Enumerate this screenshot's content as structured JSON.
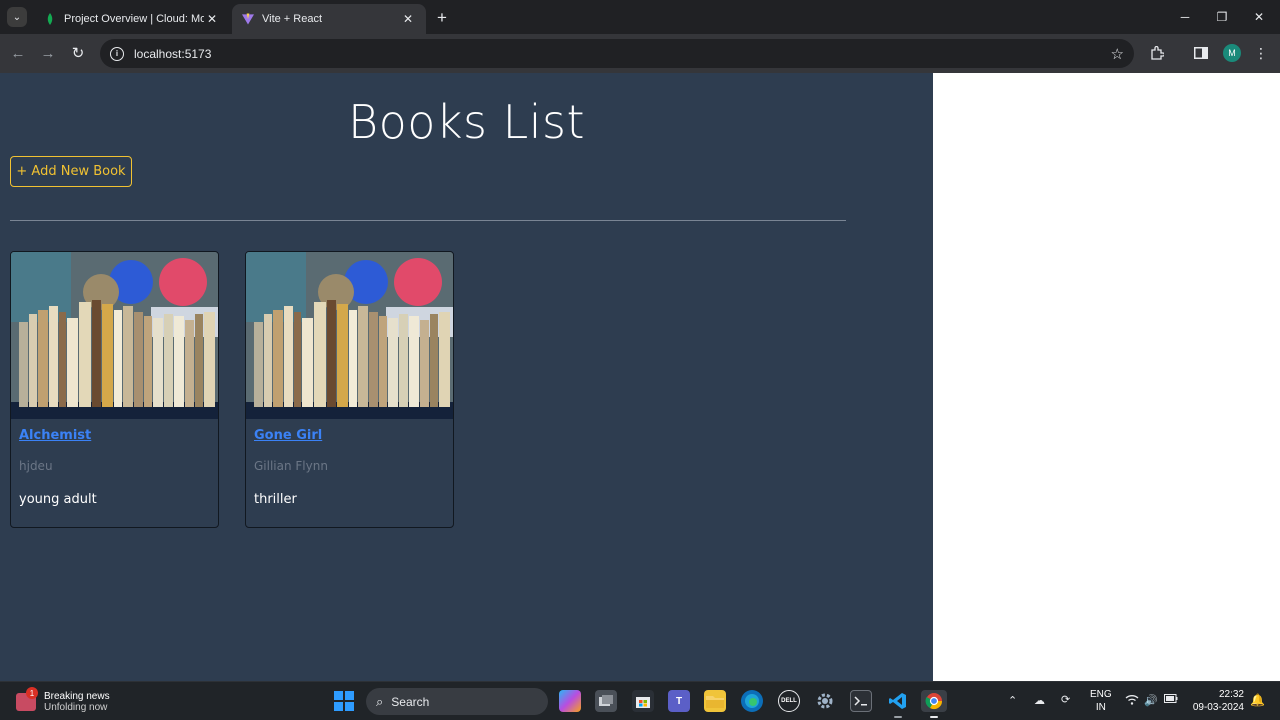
{
  "browser": {
    "tabs": [
      {
        "title": "Project Overview | Cloud: Mong",
        "active": false
      },
      {
        "title": "Vite + React",
        "active": true
      }
    ],
    "url": "localhost:5173",
    "profile_initial": "M"
  },
  "page": {
    "title": "Books List",
    "add_button_label": "+ Add New Book",
    "books": [
      {
        "title": "Alchemist",
        "author": "hjdeu",
        "genre": "young adult"
      },
      {
        "title": "Gone Girl",
        "author": "Gillian Flynn",
        "genre": "thriller"
      }
    ]
  },
  "taskbar": {
    "news_line1": "Breaking news",
    "news_line2": "Unfolding now",
    "news_badge": "1",
    "search_label": "Search",
    "lang_line1": "ENG",
    "lang_line2": "IN",
    "time": "22:32",
    "date": "09-03-2024"
  },
  "colors": {
    "app_background": "#2e3d50",
    "add_button_accent": "#f1c232",
    "link_blue": "#3b82f6"
  }
}
